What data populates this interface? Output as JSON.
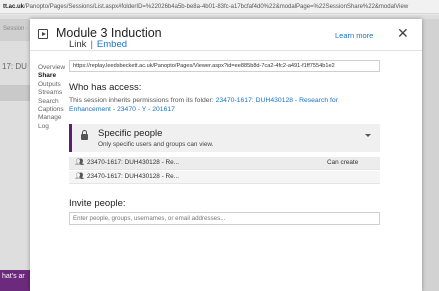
{
  "browser": {
    "url_host": "tt.ac.uk",
    "url_path": "/Panopto/Pages/Sessions/List.aspx#folderID=%22026b4a5b-be8a-4b01-83fc-a17bcfaf4d0%22&modalPage=%22SessionShare%22&modalView"
  },
  "background": {
    "top_text": "Session ·",
    "left_code": "17: DU",
    "bottom_text": "hat's ar"
  },
  "dialog": {
    "title": "Module 3 Induction",
    "learn_more": "Learn more",
    "close": "✕"
  },
  "sidebar": {
    "items": [
      {
        "label": "Overview",
        "active": false
      },
      {
        "label": "Share",
        "active": true
      },
      {
        "label": "Outputs",
        "active": false
      },
      {
        "label": "Streams",
        "active": false
      },
      {
        "label": "Search",
        "active": false
      },
      {
        "label": "Captions",
        "active": false
      },
      {
        "label": "Manage",
        "active": false
      },
      {
        "label": "Log",
        "active": false
      }
    ]
  },
  "share": {
    "tab_link": "Link",
    "tab_separator": "|",
    "tab_embed": "Embed",
    "link_url": "https://replay.leedsbeckett.ac.uk/Panopto/Pages/Viewer.aspx?id=ee885b8d-7ca2-4fc2-a491-f1ff7554b1e2",
    "who_label": "Who has access:",
    "inherit_text": "This session inherits permissions from its folder:",
    "inherit_link": "23470-1617: DUH430128 - Research for Enhancement - 23470 - Y - 201617",
    "permission_title": "Specific people",
    "permission_subtitle": "Only specific users and groups can view.",
    "access_rows": [
      {
        "name": "23470-1617: DUH430128 - Re...",
        "role": "Can create"
      },
      {
        "name": "23470-1617: DUH430128 - Re...",
        "role": ""
      }
    ],
    "invite_label": "Invite people:",
    "invite_placeholder": "Enter people, groups, usernames, or email addresses..."
  },
  "colors": {
    "accent_link": "#1a73c7",
    "permission_bar": "#5b1f6e"
  }
}
